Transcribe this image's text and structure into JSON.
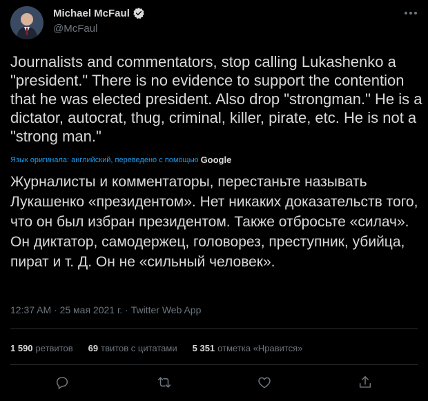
{
  "author": {
    "name": "Michael McFaul",
    "handle": "@McFaul"
  },
  "tweet": {
    "text_en": "Journalists and commentators, stop calling Lukashenko a \"president.\" There is no evidence to support the contention that he was elected president. Also drop \"strongman.\" He is a dictator, autocrat, thug, criminal, killer, pirate, etc. He is not a \"strong man.\"",
    "translation_note": "Язык оригинала: английский, переведено с помощью",
    "translation_provider": "Google",
    "text_ru": "Журналисты и комментаторы, перестаньте называть Лукашенко «президентом». Нет никаких доказательств того, что он был избран президентом. Также отбросьте «силач». Он диктатор, самодержец, головорез, преступник, убийца, пират и т. Д. Он не «сильный человек».",
    "timestamp": "12:37 AM · 25 мая 2021 г. · Twitter Web App"
  },
  "stats": {
    "retweets_count": "1 590",
    "retweets_label": "ретвитов",
    "quotes_count": "69",
    "quotes_label": "твитов с цитатами",
    "likes_count": "5 351",
    "likes_label": "отметка «Нравится»"
  },
  "icons": {
    "verified": "verified-badge-icon",
    "more": "more-options-icon",
    "reply": "reply-icon",
    "retweet": "retweet-icon",
    "like": "like-icon",
    "share": "share-icon"
  },
  "colors": {
    "background": "#000000",
    "text": "#d9d9d9",
    "muted": "#6e767d",
    "accent": "#1d9bf0",
    "divider": "#2f3336"
  }
}
